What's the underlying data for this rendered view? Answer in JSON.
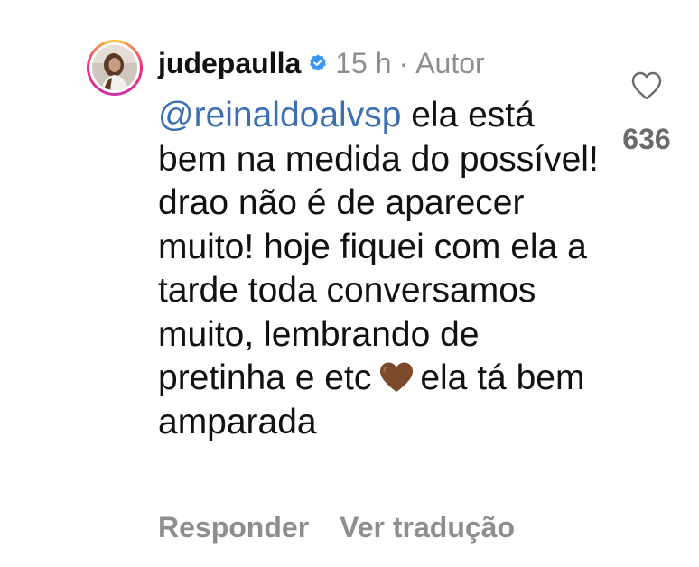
{
  "comment": {
    "username": "judepaulla",
    "verified": true,
    "time": "15 h",
    "separator": "·",
    "author_label": "Autor",
    "mention": "@reinaldoalvsp",
    "text_part1": " ela está bem na medida do possível! drao não é de aparecer muito! hoje fiquei com ela a tarde toda conversamos muito, lembrando de pretinha e etc",
    "emoji": "brown-heart",
    "text_part2": "ela tá bem amparada",
    "reply_label": "Responder",
    "translate_label": "Ver tradução",
    "like_count": "636"
  },
  "colors": {
    "mention": "#3c6fb0",
    "muted": "#8e8e8e",
    "verified": "#3897f0",
    "emoji_heart": "#7b4a2a"
  }
}
